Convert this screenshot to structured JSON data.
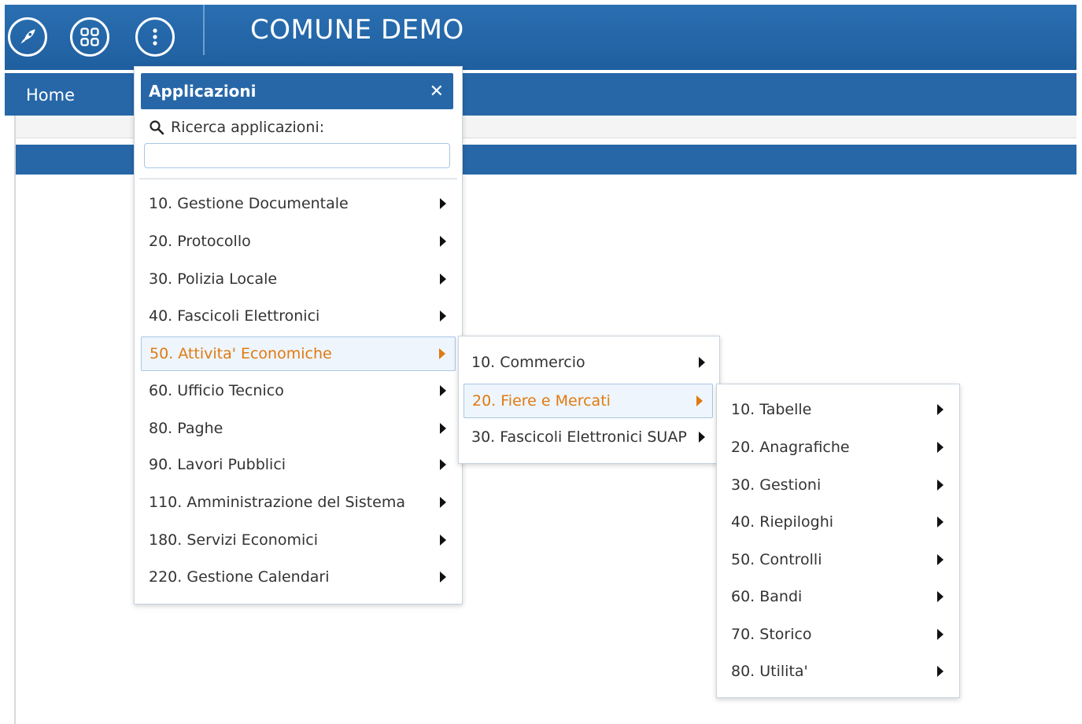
{
  "header": {
    "title": "COMUNE DEMO",
    "icons": [
      "rocket-icon",
      "apps-grid-icon",
      "more-vertical-icon"
    ]
  },
  "nav": {
    "home_label": "Home"
  },
  "apps_menu": {
    "title": "Applicazioni",
    "close_symbol": "✕",
    "search_label": "Ricerca applicazioni:",
    "search_value": "",
    "items": [
      "10. Gestione Documentale",
      "20. Protocollo",
      "30. Polizia Locale",
      "40. Fascicoli Elettronici",
      "50. Attivita' Economiche",
      "60. Ufficio Tecnico",
      "80. Paghe",
      "90. Lavori Pubblici",
      "110. Amministrazione del Sistema",
      "180. Servizi Economici",
      "220. Gestione Calendari"
    ],
    "active_item": "50. Attivita' Economiche"
  },
  "submenu_1": {
    "items": [
      "10. Commercio",
      "20. Fiere e Mercati",
      "30. Fascicoli Elettronici SUAP"
    ],
    "active_item": "20. Fiere e Mercati"
  },
  "submenu_2": {
    "items": [
      "10. Tabelle",
      "20. Anagrafiche",
      "30. Gestioni",
      "40. Riepiloghi",
      "50. Controlli",
      "60. Bandi",
      "70. Storico",
      "80. Utilita'"
    ]
  },
  "colors": {
    "primary_blue": "#2767a8",
    "active_orange": "#e07a10",
    "active_bg": "#eef5fc"
  }
}
